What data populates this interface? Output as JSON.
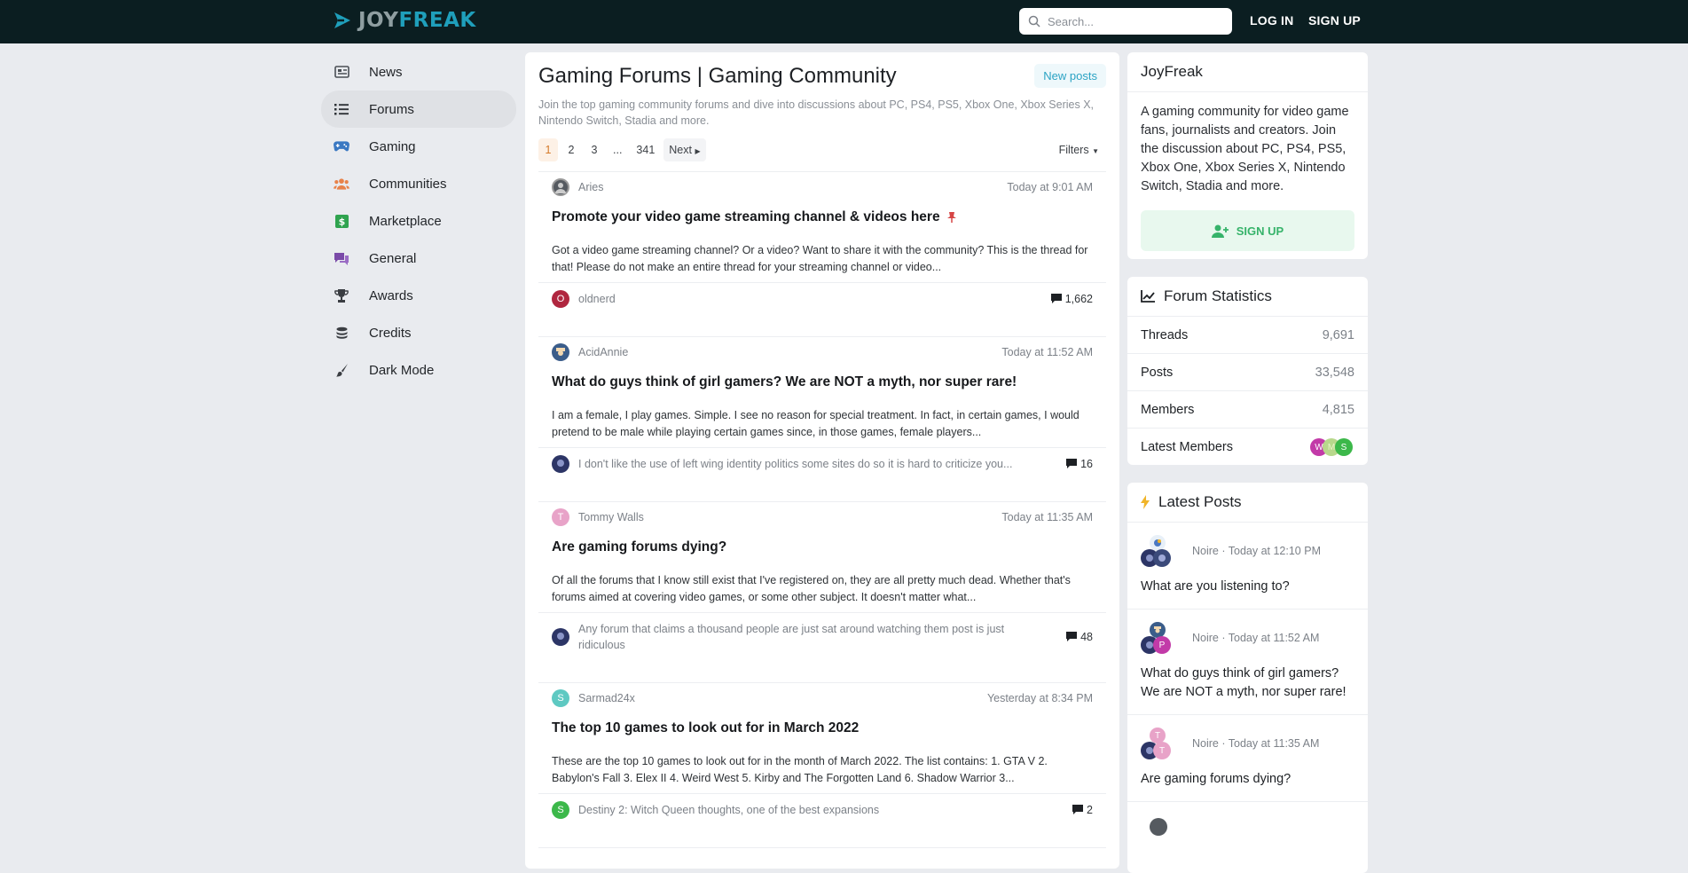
{
  "brand": {
    "joy": "JOY",
    "freak": "FREAK",
    "accent": "#1f9fbb",
    "topbar_bg": "#0b1e21"
  },
  "search": {
    "placeholder": "Search..."
  },
  "auth": {
    "login": "LOG IN",
    "signup": "SIGN UP"
  },
  "sidebar": {
    "items": [
      {
        "label": "News",
        "icon": "newspaper-icon",
        "color": "#4a4f55"
      },
      {
        "label": "Forums",
        "icon": "list-icon",
        "color": "#4a4f55",
        "active": true
      },
      {
        "label": "Gaming",
        "icon": "gamepad-icon",
        "color": "#3a78c2"
      },
      {
        "label": "Communities",
        "icon": "users-icon",
        "color": "#e8824a"
      },
      {
        "label": "Marketplace",
        "icon": "money-icon",
        "color": "#2fa34f"
      },
      {
        "label": "General",
        "icon": "comments-icon",
        "color": "#7a4aa8"
      },
      {
        "label": "Awards",
        "icon": "trophy-icon",
        "color": "#3a3d42"
      },
      {
        "label": "Credits",
        "icon": "coins-icon",
        "color": "#3a3d42"
      },
      {
        "label": "Dark Mode",
        "icon": "brush-icon",
        "color": "#3a3d42"
      }
    ]
  },
  "main": {
    "title": "Gaming Forums | Gaming Community",
    "new_posts": "New posts",
    "description": "Join the top gaming community forums and dive into discussions about PC, PS4, PS5, Xbox One, Xbox Series X, Nintendo Switch, Stadia and more.",
    "pager": {
      "pages": [
        "1",
        "2",
        "3",
        "...",
        "341"
      ],
      "next": "Next",
      "current": "1"
    },
    "filters": "Filters",
    "threads": [
      {
        "author": "Aries",
        "time": "Today at 9:01 AM",
        "title": "Promote your video game streaming channel & videos here",
        "pinned": true,
        "excerpt": "Got a video game streaming channel? Or a video? Want to share it with the community? This is the thread for that! Please do not make an entire thread for your streaming channel or video...",
        "last": "oldnerd",
        "replies": "1,662",
        "author_avatar": {
          "letter": "",
          "color": "#555a60"
        },
        "last_avatar": {
          "letter": "O",
          "color": "#b0263f"
        }
      },
      {
        "author": "AcidAnnie",
        "time": "Today at 11:52 AM",
        "title": "What do guys think of girl gamers? We are NOT a myth, nor super rare!",
        "pinned": false,
        "excerpt": "I am a female, I play games. Simple. I see no reason for special treatment. In fact, in certain games, I would pretend to be male while playing certain games since, in those games, female players...",
        "last": "I don't like the use of left wing identity politics some sites do so it is hard to criticize you...",
        "replies": "16",
        "author_avatar": {
          "letter": "",
          "color": "#3b5d8a"
        },
        "last_avatar": {
          "letter": "",
          "color": "#2c3566"
        }
      },
      {
        "author": "Tommy Walls",
        "time": "Today at 11:35 AM",
        "title": "Are gaming forums dying?",
        "pinned": false,
        "excerpt": "Of all the forums that I know still exist that I've registered on, they are all pretty much dead. Whether that's forums aimed at covering video games, or some other subject. It doesn't matter what...",
        "last": "Any forum that claims a thousand people are just sat around watching them post is just ridiculous",
        "replies": "48",
        "author_avatar": {
          "letter": "T",
          "color": "#e8a3c8"
        },
        "last_avatar": {
          "letter": "",
          "color": "#2c3566"
        }
      },
      {
        "author": "Sarmad24x",
        "time": "Yesterday at 8:34 PM",
        "title": "The top 10 games to look out for in March 2022",
        "pinned": false,
        "excerpt": "These are the top 10 games to look out for in the month of March 2022. The list contains: 1. GTA V 2. Babylon's Fall 3. Elex II 4. Weird West 5. Kirby and The Forgotten Land 6. Shadow Warrior 3...",
        "last": "Destiny 2: Witch Queen thoughts, one of the best expansions",
        "replies": "2",
        "author_avatar": {
          "letter": "S",
          "color": "#5ec9c2"
        },
        "last_avatar": {
          "letter": "S",
          "color": "#3cb84a"
        }
      }
    ]
  },
  "about": {
    "title": "JoyFreak",
    "text": "A gaming community for video game fans, journalists and creators. Join the discussion about PC, PS4, PS5, Xbox One, Xbox Series X, Nintendo Switch, Stadia and more.",
    "signup": "SIGN UP"
  },
  "stats": {
    "title": "Forum Statistics",
    "rows": [
      {
        "label": "Threads",
        "value": "9,691"
      },
      {
        "label": "Posts",
        "value": "33,548"
      },
      {
        "label": "Members",
        "value": "4,815"
      }
    ],
    "latest_members_label": "Latest Members",
    "latest_members": [
      {
        "letter": "W",
        "color": "#c23aa8"
      },
      {
        "letter": "M",
        "color": "#b8d88c"
      },
      {
        "letter": "S",
        "color": "#3cb84a"
      }
    ]
  },
  "latest_posts": {
    "title": "Latest Posts",
    "items": [
      {
        "by": "Noire · Today at 12:10 PM",
        "title": "What are you listening to?"
      },
      {
        "by": "Noire · Today at 11:52 AM",
        "title": "What do guys think of girl gamers? We are NOT a myth, nor super rare!"
      },
      {
        "by": "Noire · Today at 11:35 AM",
        "title": "Are gaming forums dying?"
      }
    ]
  }
}
